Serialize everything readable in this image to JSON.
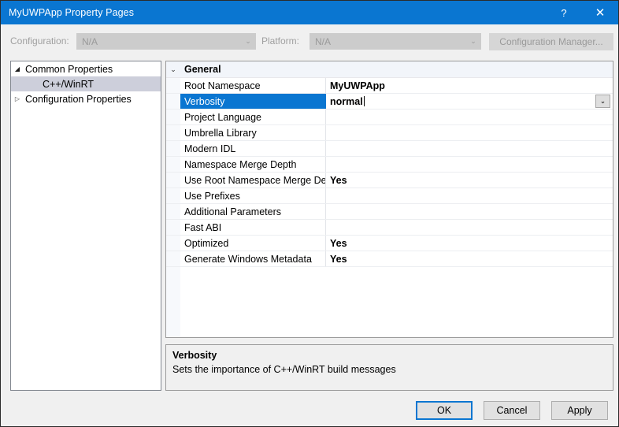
{
  "window": {
    "title": "MyUWPApp Property Pages",
    "help_icon": "?",
    "close_icon": "✕",
    "accent_color": "#0a76d1",
    "titlebar_text_color": "#ffffff"
  },
  "toolbar": {
    "configuration_label": "Configuration:",
    "configuration_value": "N/A",
    "platform_label": "Platform:",
    "platform_value": "N/A",
    "configuration_manager_label": "Configuration Manager...",
    "chevron_icon": "⌄",
    "disabled_text_color": "#9a9a9a",
    "disabled_bg_color": "#cccccc"
  },
  "tree": {
    "items": [
      {
        "label": "Common Properties",
        "expander": "◢",
        "level": 0,
        "selected": false,
        "expanded": true
      },
      {
        "label": "C++/WinRT",
        "expander": "",
        "level": 1,
        "selected": true,
        "expanded": false
      },
      {
        "label": "Configuration Properties",
        "expander": "▷",
        "level": 0,
        "selected": false,
        "expanded": false
      }
    ],
    "selection_color": "#cdcfdb"
  },
  "grid": {
    "category": {
      "label": "General",
      "chevron_icon": "⌄"
    },
    "selection_color": "#0a76d1",
    "dropdown_chevron": "⌄",
    "rows": [
      {
        "name": "Root Namespace",
        "value": "MyUWPApp",
        "selected": false,
        "has_dropdown": false
      },
      {
        "name": "Verbosity",
        "value": "normal",
        "selected": true,
        "has_dropdown": true
      },
      {
        "name": "Project Language",
        "value": "",
        "selected": false,
        "has_dropdown": false
      },
      {
        "name": "Umbrella Library",
        "value": "",
        "selected": false,
        "has_dropdown": false
      },
      {
        "name": "Modern IDL",
        "value": "",
        "selected": false,
        "has_dropdown": false
      },
      {
        "name": "Namespace Merge Depth",
        "value": "",
        "selected": false,
        "has_dropdown": false
      },
      {
        "name": "Use Root Namespace Merge Depth",
        "value": "Yes",
        "selected": false,
        "has_dropdown": false
      },
      {
        "name": "Use Prefixes",
        "value": "",
        "selected": false,
        "has_dropdown": false
      },
      {
        "name": "Additional Parameters",
        "value": "",
        "selected": false,
        "has_dropdown": false
      },
      {
        "name": "Fast ABI",
        "value": "",
        "selected": false,
        "has_dropdown": false
      },
      {
        "name": "Optimized",
        "value": "Yes",
        "selected": false,
        "has_dropdown": false
      },
      {
        "name": "Generate Windows Metadata",
        "value": "Yes",
        "selected": false,
        "has_dropdown": false
      }
    ]
  },
  "description": {
    "title": "Verbosity",
    "body": "Sets the importance of C++/WinRT build messages"
  },
  "footer": {
    "ok_label": "OK",
    "cancel_label": "Cancel",
    "apply_label": "Apply"
  }
}
